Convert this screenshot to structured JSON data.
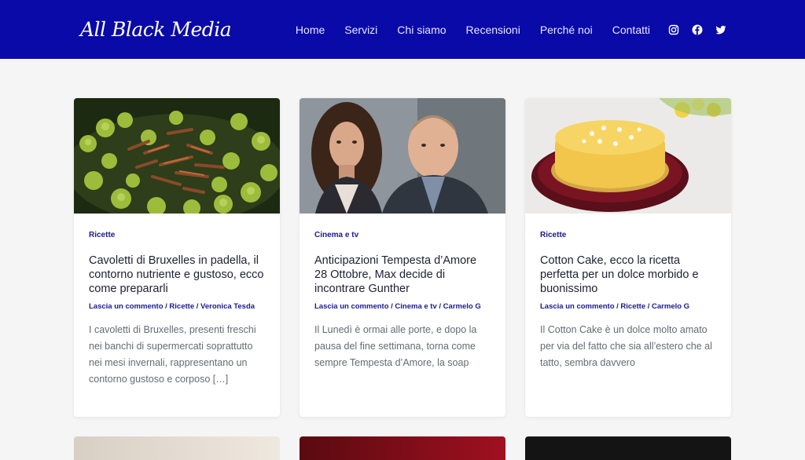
{
  "header": {
    "logo": "All Black Media",
    "nav": [
      "Home",
      "Servizi",
      "Chi siamo",
      "Recensioni",
      "Perché noi",
      "Contatti"
    ],
    "socials": [
      "instagram-icon",
      "facebook-icon",
      "twitter-icon"
    ],
    "bg_color": "#0a0aa8"
  },
  "posts": [
    {
      "category": "Ricette",
      "title": "Cavoletti di Bruxelles in padella, il contorno nutriente e gustoso, ecco come prepararli",
      "meta_comment": "Lascia un commento",
      "meta_category": "Ricette",
      "meta_author": "Veronica Tesda",
      "excerpt": "I cavoletti di Bruxelles, presenti freschi nei banchi di supermercati soprattutto nei mesi invernali, rappresentano un contorno gustoso e corposo […]"
    },
    {
      "category": "Cinema e tv",
      "title": "Anticipazioni Tempesta d’Amore 28 Ottobre, Max decide di incontrare Gunther",
      "meta_comment": "Lascia un commento",
      "meta_category": "Cinema e tv",
      "meta_author": "Carmelo G",
      "excerpt": "Il Lunedì è ormai alle porte, e dopo la pausa del fine settimana, torna come sempre Tempesta d’Amore, la soap"
    },
    {
      "category": "Ricette",
      "title": "Cotton Cake, ecco la ricetta perfetta per un dolce morbido e buonissimo",
      "meta_comment": "Lascia un commento",
      "meta_category": "Ricette",
      "meta_author": "Carmelo G",
      "excerpt": "Il Cotton Cake è un dolce molto amato per via del fatto che sia all’estero che al tatto, sembra davvero"
    }
  ],
  "sep": " / "
}
